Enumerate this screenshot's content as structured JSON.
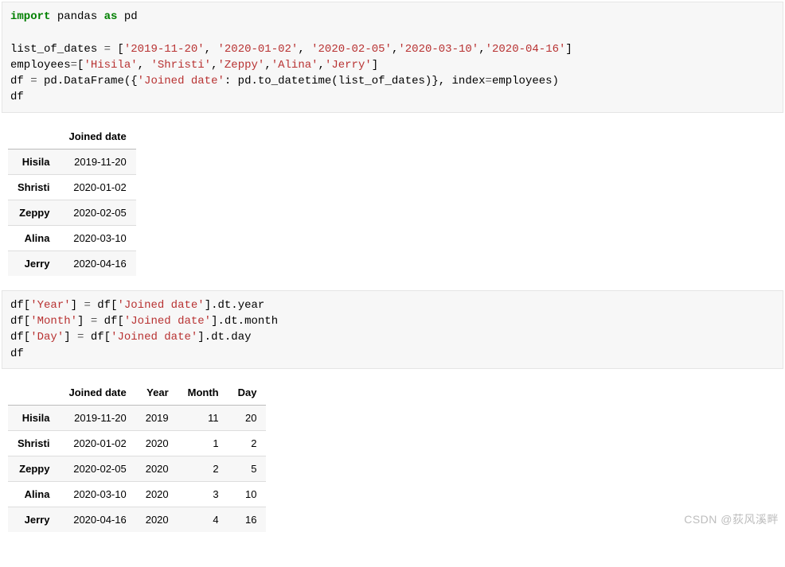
{
  "code1": {
    "line1": {
      "t1": "import",
      "t2": " pandas ",
      "t3": "as",
      "t4": " pd"
    },
    "blank": " ",
    "line2": {
      "t1": "list_of_dates ",
      "op1": "=",
      "t2": " [",
      "s1": "'2019-11-20'",
      "c1": ", ",
      "s2": "'2020-01-02'",
      "c2": ", ",
      "s3": "'2020-02-05'",
      "c3": ",",
      "s4": "'2020-03-10'",
      "c4": ",",
      "s5": "'2020-04-16'",
      "t3": "]"
    },
    "line3": {
      "t1": "employees",
      "op1": "=",
      "t2": "[",
      "s1": "'Hisila'",
      "c1": ", ",
      "s2": "'Shristi'",
      "c2": ",",
      "s3": "'Zeppy'",
      "c3": ",",
      "s4": "'Alina'",
      "c4": ",",
      "s5": "'Jerry'",
      "t3": "]"
    },
    "line4": {
      "t1": "df ",
      "op1": "=",
      "t2": " pd.DataFrame({",
      "s1": "'Joined date'",
      "t3": ": pd.to_datetime(list_of_dates)}, index",
      "op2": "=",
      "t4": "employees)"
    },
    "line5": {
      "t1": "df"
    }
  },
  "table1": {
    "headers": [
      "Joined date"
    ],
    "rows": [
      {
        "idx": "Hisila",
        "cells": [
          "2019-11-20"
        ]
      },
      {
        "idx": "Shristi",
        "cells": [
          "2020-01-02"
        ]
      },
      {
        "idx": "Zeppy",
        "cells": [
          "2020-02-05"
        ]
      },
      {
        "idx": "Alina",
        "cells": [
          "2020-03-10"
        ]
      },
      {
        "idx": "Jerry",
        "cells": [
          "2020-04-16"
        ]
      }
    ]
  },
  "code2": {
    "line1": {
      "t1": "df[",
      "s1": "'Year'",
      "t2": "] ",
      "op1": "=",
      "t3": " df[",
      "s2": "'Joined date'",
      "t4": "].dt.year"
    },
    "line2": {
      "t1": "df[",
      "s1": "'Month'",
      "t2": "] ",
      "op1": "=",
      "t3": " df[",
      "s2": "'Joined date'",
      "t4": "].dt.month"
    },
    "line3": {
      "t1": "df[",
      "s1": "'Day'",
      "t2": "] ",
      "op1": "=",
      "t3": " df[",
      "s2": "'Joined date'",
      "t4": "].dt.day"
    },
    "line4": {
      "t1": "df"
    }
  },
  "table2": {
    "headers": [
      "Joined date",
      "Year",
      "Month",
      "Day"
    ],
    "rows": [
      {
        "idx": "Hisila",
        "cells": [
          "2019-11-20",
          "2019",
          "11",
          "20"
        ]
      },
      {
        "idx": "Shristi",
        "cells": [
          "2020-01-02",
          "2020",
          "1",
          "2"
        ]
      },
      {
        "idx": "Zeppy",
        "cells": [
          "2020-02-05",
          "2020",
          "2",
          "5"
        ]
      },
      {
        "idx": "Alina",
        "cells": [
          "2020-03-10",
          "2020",
          "3",
          "10"
        ]
      },
      {
        "idx": "Jerry",
        "cells": [
          "2020-04-16",
          "2020",
          "4",
          "16"
        ]
      }
    ]
  },
  "watermark": "CSDN @荻风溪畔"
}
